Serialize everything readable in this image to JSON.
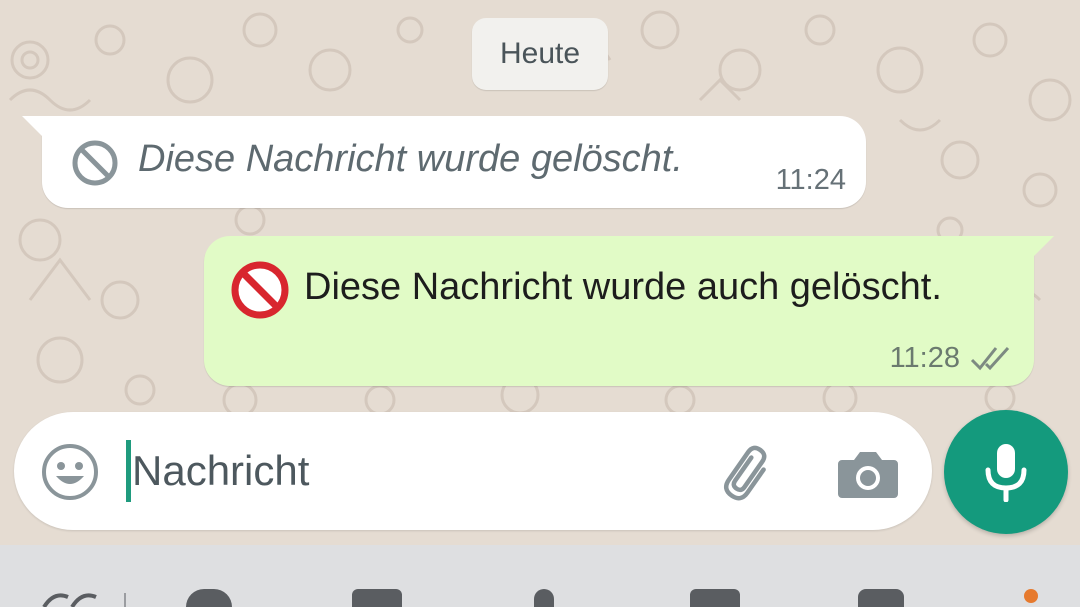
{
  "chat": {
    "date_chip": "Heute",
    "incoming": {
      "text": "Diese Nachricht wurde gelöscht.",
      "time": "11:24",
      "icon": "deleted-message-icon"
    },
    "outgoing": {
      "text": "Diese Nachricht wurde auch gelöscht.",
      "time": "11:28",
      "icon": "prohibited-emoji",
      "status_icon": "double-check-icon"
    }
  },
  "composer": {
    "placeholder": "Nachricht",
    "emoji_icon": "emoji-icon",
    "attach_icon": "paperclip-icon",
    "camera_icon": "camera-icon",
    "mic_icon": "microphone-icon"
  },
  "colors": {
    "accent": "#149a7d",
    "outgoing_bubble": "#e1fbc6",
    "incoming_bubble": "#ffffff",
    "chat_background": "#e5dcd2",
    "notification_dot": "#e67a2e"
  }
}
